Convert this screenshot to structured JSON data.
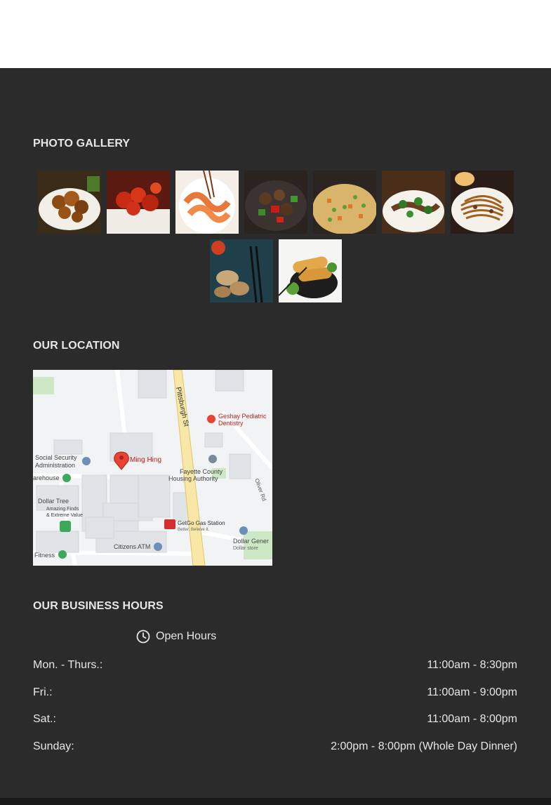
{
  "gallery": {
    "title": "PHOTO GALLERY",
    "photos": [
      {
        "name": "General Tso's chicken"
      },
      {
        "name": "Sweet and sour chicken"
      },
      {
        "name": "Shrimp dish"
      },
      {
        "name": "Pepper steak"
      },
      {
        "name": "Fried rice"
      },
      {
        "name": "Beef with broccoli"
      },
      {
        "name": "Lo mein"
      },
      {
        "name": "Dumplings"
      },
      {
        "name": "Egg rolls"
      }
    ]
  },
  "location": {
    "title": "OUR LOCATION",
    "map": {
      "street_pittsburgh": "Pittsburgh St",
      "street_oliver": "Oliver Rd",
      "pin_label": "Ming Hing",
      "poi_ssa": "Social Security",
      "poi_ssa_2": "Administration",
      "poi_warehouse": "arehouse",
      "poi_geshay": "Geshay Pediatric",
      "poi_geshay_2": "Dentistry",
      "poi_housing": "Fayette County",
      "poi_housing_2": "Housing Authority",
      "poi_dollar_tree": "Dollar Tree",
      "poi_dollar_tree_2": "Amazing Finds",
      "poi_dollar_tree_3": "& Extreme Value",
      "poi_getgo": "GetGo Gas Station",
      "poi_getgo_2": "Better. Believe It.",
      "poi_citizens": "Citizens ATM",
      "poi_dollar_general": "Dollar Gener",
      "poi_dollar_general_2": "Dollar store",
      "poi_fitness": "Fitness"
    }
  },
  "hours": {
    "title": "OUR BUSINESS HOURS",
    "open_label": "Open Hours",
    "rows": [
      {
        "day": "Mon. - Thurs.:",
        "time": "11:00am - 8:30pm"
      },
      {
        "day": "Fri.:",
        "time": "11:00am - 9:00pm"
      },
      {
        "day": "Sat.:",
        "time": "11:00am - 8:00pm"
      },
      {
        "day": "Sunday:",
        "time": "2:00pm - 8:00pm (Whole Day Dinner)"
      }
    ]
  },
  "colors": {
    "background_dark": "#2b2b2b",
    "text_light": "#e6e6e6",
    "map_pin": "#ea4335"
  }
}
